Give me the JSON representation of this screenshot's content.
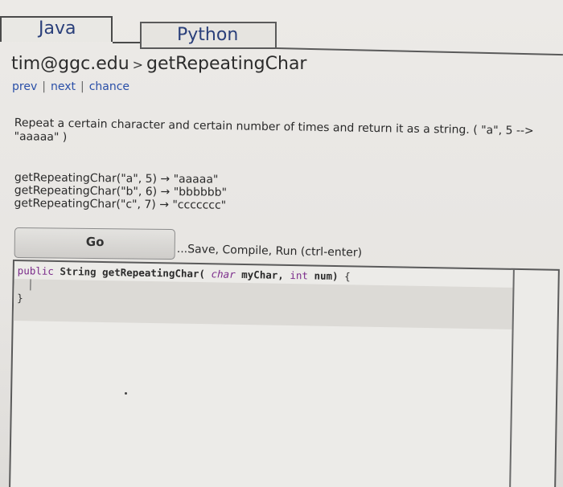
{
  "tabs": [
    {
      "label": "Java"
    },
    {
      "label": "Python"
    }
  ],
  "breadcrumb": {
    "user": "tim@ggc.edu",
    "separator": ">",
    "problem": "getRepeatingChar"
  },
  "subnav": {
    "prev": "prev",
    "next": "next",
    "chance": "chance",
    "divider": "|"
  },
  "description": "Repeat a certain character and certain number of times and return it as a string. ( \"a\", 5 --> \"aaaaa\" )",
  "examples": [
    "getRepeatingChar(\"a\", 5) → \"aaaaa\"",
    "getRepeatingChar(\"b\", 6) → \"bbbbbb\"",
    "getRepeatingChar(\"c\", 7) → \"ccccccc\""
  ],
  "go_button": {
    "label": "Go"
  },
  "save_hint": "...Save, Compile, Run (ctrl-enter)",
  "editor": {
    "line1": {
      "kw1": "public",
      "type": "String",
      "fn": "getRepeatingChar(",
      "ptype1": "char",
      "pname1": "myChar,",
      "ptype2": "int",
      "pname2": "num)",
      "brace": "{"
    },
    "line2": "}"
  },
  "colors": {
    "link": "#2a4fa8",
    "tab_text": "#2a3f7a",
    "keyword": "#7a2a8a"
  }
}
